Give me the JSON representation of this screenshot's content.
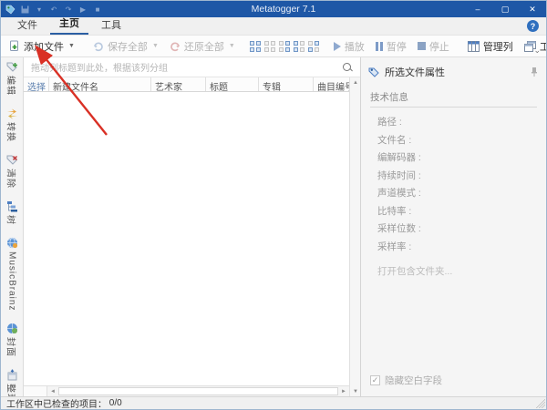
{
  "window": {
    "title": "Metatogger 7.1"
  },
  "titlebar": {
    "minimize": "–",
    "maximize": "▢",
    "close": "✕"
  },
  "tabs": [
    {
      "label": "文件"
    },
    {
      "label": "主页",
      "active": true
    },
    {
      "label": "工具"
    }
  ],
  "help": {
    "label": "?"
  },
  "toolbar": {
    "add_files": "添加文件",
    "save_all": "保存全部",
    "restore_all": "还原全部",
    "play": "播放",
    "pause": "暂停",
    "stop": "停止",
    "manage_columns": "管理列",
    "workspace": "工作空间",
    "more": "···",
    "collapse": "⌄"
  },
  "sidebar": {
    "items": [
      {
        "label": "编辑"
      },
      {
        "label": "转换"
      },
      {
        "label": "清除"
      },
      {
        "label": "树"
      },
      {
        "label": "MusicBrainz"
      },
      {
        "label": "封面"
      },
      {
        "label": "整理"
      }
    ]
  },
  "group_bar": {
    "placeholder": "拖动列标题到此处，根据该列分组"
  },
  "table": {
    "columns": [
      "选择",
      "新建文件名",
      "艺术家",
      "标题",
      "专辑",
      "曲目编号"
    ],
    "rows": []
  },
  "properties_panel": {
    "title": "所选文件属性",
    "section": "技术信息",
    "fields": [
      "路径 :",
      "文件名 :",
      "编解码器 :",
      "持续时间 :",
      "声道模式 :",
      "比特率 :",
      "采样位数 :",
      "采样率 :"
    ],
    "open_folder_link": "打开包含文件夹...",
    "hide_empty_checkbox": {
      "checked": true,
      "label": "隐藏空白字段"
    }
  },
  "status_bar": {
    "label": "工作区中已检查的项目：",
    "count": "0/0"
  },
  "colors": {
    "titlebar": "#1e57a6",
    "tab_underline": "#2b5fa3",
    "accent_blue": "#2f6fbe",
    "disabled_text": "#b3b3b3",
    "annotation_arrow": "#d93025",
    "panel_bg": "#f5f5f5",
    "add_icon_green": "#4ea64e",
    "restore_icon_red": "#d07070"
  }
}
